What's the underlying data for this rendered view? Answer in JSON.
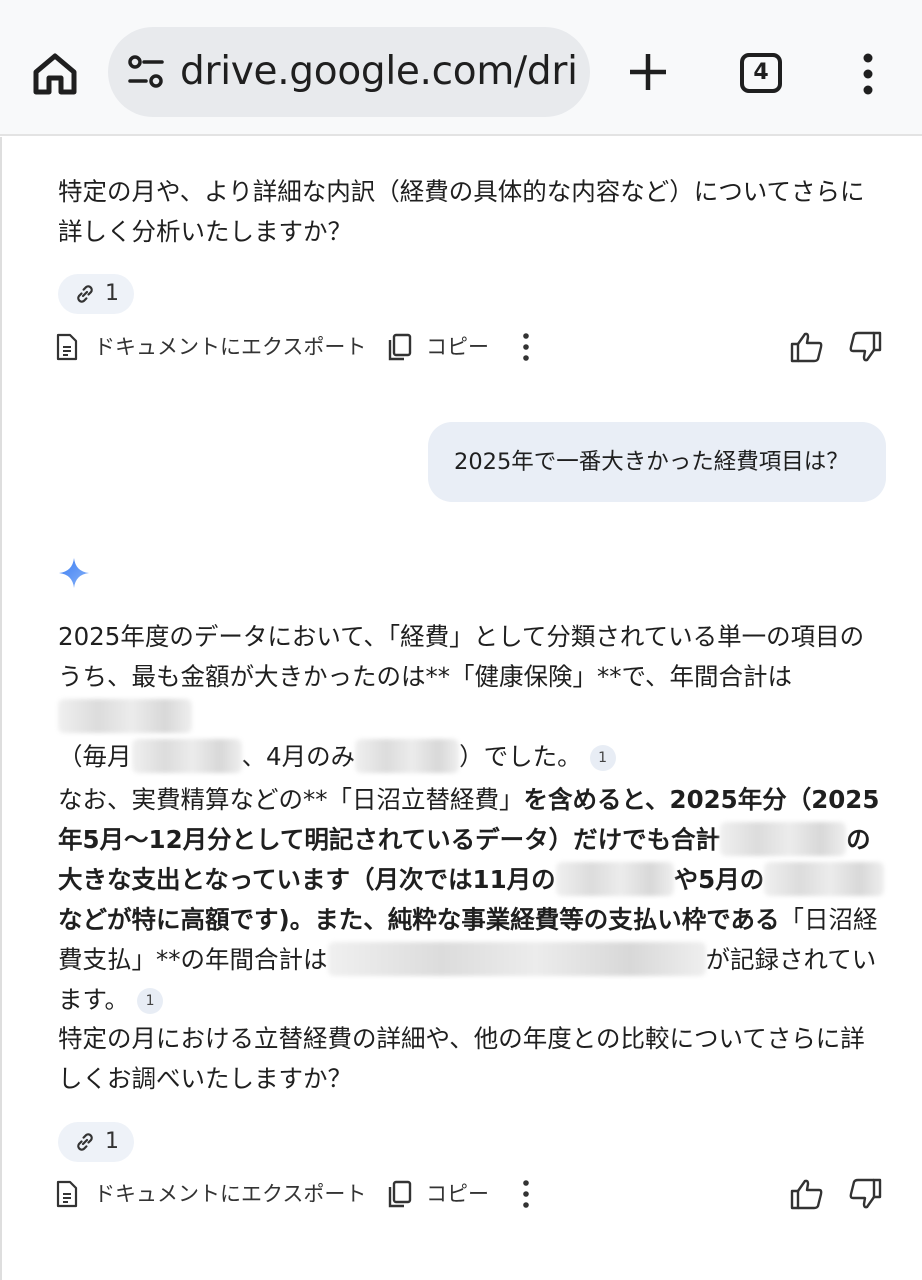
{
  "browser": {
    "url": "drive.google.com/drive",
    "tab_count": "4",
    "icons": [
      "home-icon",
      "site-settings-icon",
      "new-tab-plus-icon",
      "tab-switcher-icon",
      "more-vert-icon"
    ]
  },
  "chat": {
    "msg1_tail": "特定の月や、より詳細な内訳（経費の具体的な内容など）についてさらに詳しく分析いたしますか？",
    "sources_count": "1",
    "actions": {
      "export_label": "ドキュメントにエクスポート",
      "copy_label": "コピー"
    },
    "user_message": "2025年で一番大きかった経費項目は？",
    "response": {
      "p1_a": "2025年度のデータにおいて、「経費」として分類されている単一の項目のうち、最も金額が大きかったのは**「健康保険」**で、年間合計は",
      "p1_b": "（毎月",
      "p1_c": "、4月のみ",
      "p1_d": "）でした。",
      "p2_a": "なお、実費精算などの**「日沼立替経費」",
      "p2_b": "を含めると、2025年分（2025年5月～12月分として明記されているデータ）だけでも合計",
      "p2_c": "の大きな支出となっています（月次では11月の",
      "p2_d": "や5月の",
      "p2_e": "などが特に高額です)。また、純粋な事業経費等の支払い枠である",
      "p2_f": "「日沼経費支払」**の年間合計は",
      "p2_g": "が記録されています。",
      "p3": "特定の月における立替経費の詳細や、他の年度との比較についてさらに詳しくお調べいたしますか？",
      "citation": "1"
    }
  },
  "colors": {
    "topbar_bg": "#f8f9fa",
    "urlbar_bg": "#e8eaed",
    "user_bubble_bg": "#e9eef6",
    "chip_bg": "#eef2f8",
    "spark_accent": "#4b8df8"
  }
}
